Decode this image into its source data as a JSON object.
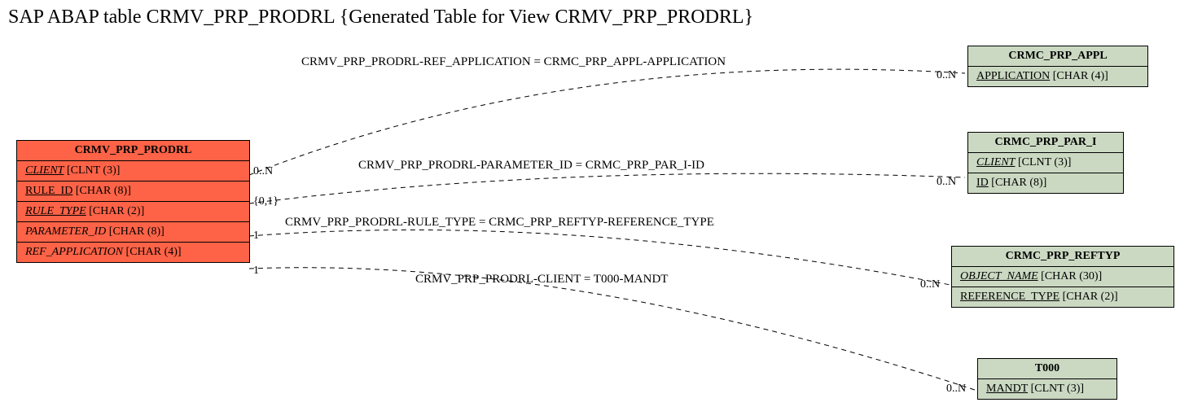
{
  "title": "SAP ABAP table CRMV_PRP_PRODRL {Generated Table for View CRMV_PRP_PRODRL}",
  "main_entity": {
    "name": "CRMV_PRP_PRODRL",
    "fields": [
      {
        "name": "CLIENT",
        "type": "[CLNT (3)]",
        "style": "italic-underline"
      },
      {
        "name": "RULE_ID",
        "type": "[CHAR (8)]",
        "style": "underline"
      },
      {
        "name": "RULE_TYPE",
        "type": "[CHAR (2)]",
        "style": "italic-underline"
      },
      {
        "name": "PARAMETER_ID",
        "type": "[CHAR (8)]",
        "style": "italic"
      },
      {
        "name": "REF_APPLICATION",
        "type": "[CHAR (4)]",
        "style": "italic"
      }
    ]
  },
  "rel_entities": [
    {
      "id": "appl",
      "name": "CRMC_PRP_APPL",
      "fields": [
        {
          "name": "APPLICATION",
          "type": "[CHAR (4)]",
          "style": "underline"
        }
      ]
    },
    {
      "id": "par_i",
      "name": "CRMC_PRP_PAR_I",
      "fields": [
        {
          "name": "CLIENT",
          "type": "[CLNT (3)]",
          "style": "italic-underline"
        },
        {
          "name": "ID",
          "type": "[CHAR (8)]",
          "style": "underline"
        }
      ]
    },
    {
      "id": "reftyp",
      "name": "CRMC_PRP_REFTYP",
      "fields": [
        {
          "name": "OBJECT_NAME",
          "type": "[CHAR (30)]",
          "style": "italic-underline"
        },
        {
          "name": "REFERENCE_TYPE",
          "type": "[CHAR (2)]",
          "style": "underline"
        }
      ]
    },
    {
      "id": "t000",
      "name": "T000",
      "fields": [
        {
          "name": "MANDT",
          "type": "[CLNT (3)]",
          "style": "underline"
        }
      ]
    }
  ],
  "connections": [
    {
      "label": "CRMV_PRP_PRODRL-REF_APPLICATION = CRMC_PRP_APPL-APPLICATION",
      "left_card": "0..N",
      "right_card": "0..N"
    },
    {
      "label": "CRMV_PRP_PRODRL-PARAMETER_ID = CRMC_PRP_PAR_I-ID",
      "left_card": "{0,1}",
      "right_card": "0..N"
    },
    {
      "label": "CRMV_PRP_PRODRL-RULE_TYPE = CRMC_PRP_REFTYP-REFERENCE_TYPE",
      "left_card": "1",
      "right_card": "0..N"
    },
    {
      "label": "CRMV_PRP_PRODRL-CLIENT = T000-MANDT",
      "left_card": "1",
      "right_card": "0..N"
    }
  ]
}
